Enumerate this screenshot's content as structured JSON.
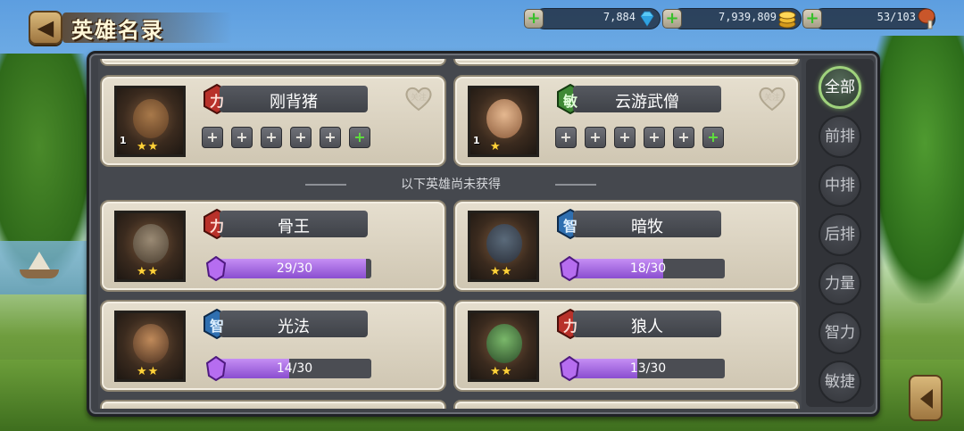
{
  "header": {
    "back_icon": "back-arrow-icon",
    "title": "英雄名录"
  },
  "resources": [
    {
      "name": "diamonds",
      "value": "7,884",
      "icon": "diamond-icon"
    },
    {
      "name": "gold",
      "value": "7,939,809",
      "icon": "gold-coin-icon"
    },
    {
      "name": "stamina",
      "value": "53/103",
      "icon": "meat-drumstick-icon"
    }
  ],
  "owned_heroes": [
    {
      "name": "刚背猪",
      "class": "力",
      "class_color": "#b8312a",
      "level": "1",
      "stars": 2,
      "fav_label": "关注",
      "equip": [
        "+",
        "+",
        "+",
        "+",
        "+",
        "+"
      ],
      "equip_green_index": 5
    },
    {
      "name": "云游武僧",
      "class": "敏",
      "class_color": "#3f8a35",
      "level": "1",
      "stars": 1,
      "fav_label": "关注",
      "equip": [
        "+",
        "+",
        "+",
        "+",
        "+",
        "+"
      ],
      "equip_green_index": 5
    }
  ],
  "divider_text": "以下英雄尚未获得",
  "unowned_heroes": [
    {
      "name": "骨王",
      "class": "力",
      "class_color": "#b8312a",
      "stars": 2,
      "shards": "29/30",
      "progress": 0.967
    },
    {
      "name": "暗牧",
      "class": "智",
      "class_color": "#2f6fb0",
      "stars": 2,
      "shards": "18/30",
      "progress": 0.6
    },
    {
      "name": "光法",
      "class": "智",
      "class_color": "#2f6fb0",
      "stars": 2,
      "shards": "14/30",
      "progress": 0.467
    },
    {
      "name": "狼人",
      "class": "力",
      "class_color": "#b8312a",
      "stars": 2,
      "shards": "13/30",
      "progress": 0.433
    }
  ],
  "filter_tabs": [
    "全部",
    "前排",
    "中排",
    "后排",
    "力量",
    "智力",
    "敏捷"
  ],
  "active_tab": "全部",
  "collapse_icon": "collapse-left-icon"
}
